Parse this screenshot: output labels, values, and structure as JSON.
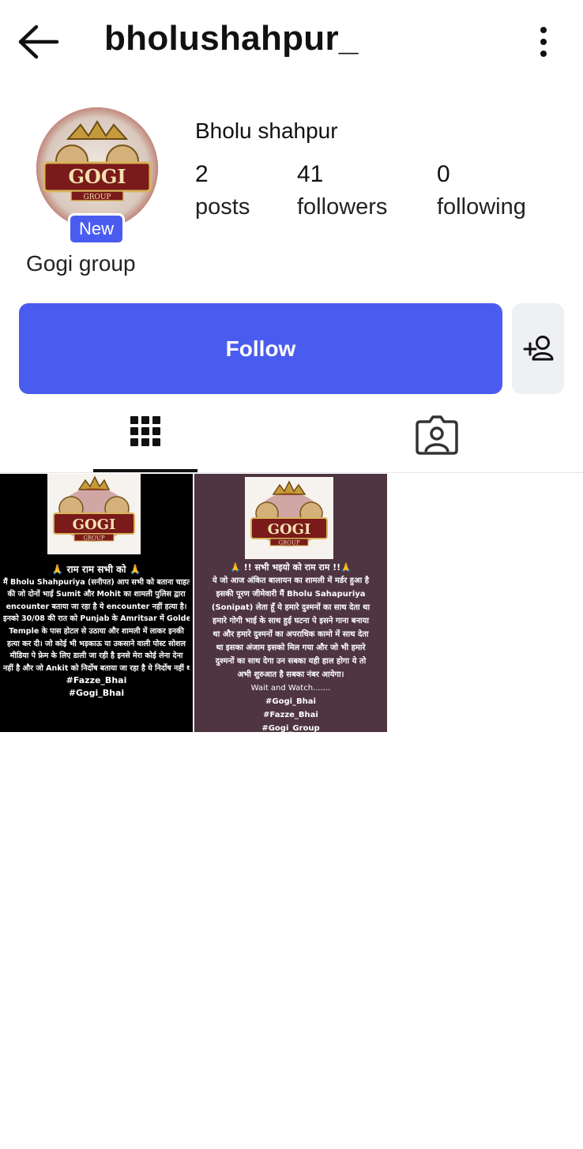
{
  "header": {
    "username": "bholushahpur_",
    "back_icon": "back-arrow-icon",
    "menu_icon": "more-vertical-icon"
  },
  "profile": {
    "full_name": "Bholu shahpur",
    "bio": "Gogi group",
    "new_badge": "New",
    "avatar_text": "GOGI",
    "avatar_subtext": "GROUP",
    "stats": [
      {
        "value": "2",
        "label": "posts"
      },
      {
        "value": "41",
        "label": "followers"
      },
      {
        "value": "0",
        "label": "following"
      }
    ]
  },
  "actions": {
    "follow_label": "Follow",
    "add_person_icon": "add-person-icon"
  },
  "tabs": {
    "grid_icon": "grid-icon",
    "tagged_icon": "tagged-person-icon"
  },
  "posts": [
    {
      "logo_text": "GOGI",
      "logo_subtext": "GROUP",
      "lines": [
        "🙏 राम राम सभी को 🙏",
        "मैं Bholu Shahpuriya (सनीपत) आप सभी को बताना चाहता हूं",
        "की जो दोनों भाई Sumit और Mohit का शामली पुलिस द्वारा",
        "encounter बताया जा रहा है ये encounter नहीं हत्या है।",
        "इनको 30/08 की रात को Punjab के Amritsar में Golden",
        "Temple के पास होटल से उठाया और शामली में लाकर इनकी",
        "हत्या कर दी। जो कोई भी भड़काऊ या उकसाने वाली पोस्ट सोशल",
        "मीडिया पे फ्रेम के लिए डाली जा रही है इनसे मेरा कोई लेना देना",
        "नहीं है और जो Ankit को निर्दोष बताया जा रहा है ये निर्दोष नहीं था।",
        "#Fazze_Bhai",
        "#Gogi_Bhai"
      ]
    },
    {
      "logo_text": "GOGI",
      "logo_subtext": "GROUP",
      "lines": [
        "🙏 !! सभी भइयो को राम राम !!🙏",
        "ये जो आज अंकित बालायन का शामली में मर्डर हुआ है",
        "इसकी पूरण जीमेवारी मैं Bholu Sahapuriya",
        "(Sonipat) लेता हूँ ये हमारे दुश्मनों का साथ देता था",
        "हमारे गोगी भाई के साथ हुई घटना पे इसने गाना बनाया",
        "था और हमारे दुश्मनों का अपराधिक कामो में साथ देता",
        "था इसका अंजाम इसको मिल गया और जो भी हमारे",
        "दुश्मनों का साथ देगा उन सबका यही हाल होगा ये तो",
        "अभी शुरुआत है सबका नंबर आयेगा।",
        "Wait and Watch.......",
        "#Gogi_Bhai",
        "#Fazze_Bhai",
        "#Gogi_Group"
      ]
    }
  ],
  "colors": {
    "accent": "#4a5cf0",
    "secondary_button": "#eef0f3",
    "post2_background": "#4e3541"
  }
}
